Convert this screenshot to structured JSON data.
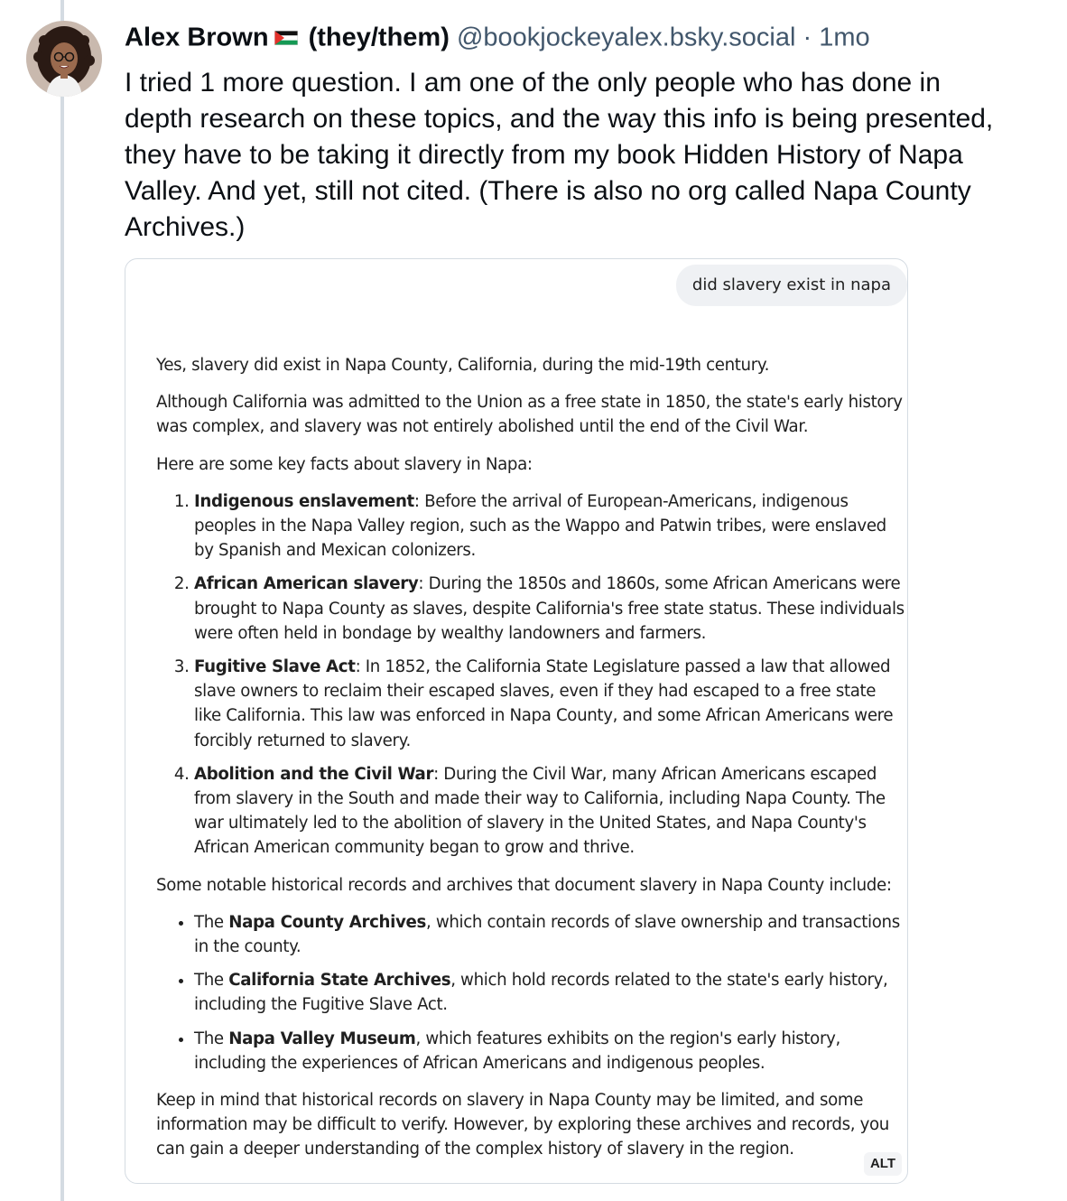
{
  "post": {
    "author_name": "Alex Brown",
    "pronouns": "(they/them)",
    "handle": "@bookjockeyalex.bsky.social",
    "separator": "·",
    "timestamp": "1mo",
    "flag_icon": "palestine-flag-icon",
    "text": "I tried 1 more question. I am one of the only people who has done in depth research on these topics, and the way this info is being presented, they have to be taking it directly from my book Hidden History of Napa Valley. And yet, still not cited. (There is also no org called Napa County Archives.)"
  },
  "image": {
    "alt_badge": "ALT",
    "user_query": "did slavery exist in napa",
    "intro": "Yes, slavery did exist in Napa County, California, during the mid-19th century.",
    "context": "Although California was admitted to the Union as a free state in 1850, the state's early history was complex, and slavery was not entirely abolished until the end of the Civil War.",
    "facts_heading": "Here are some key facts about slavery in Napa:",
    "facts": [
      {
        "title": "Indigenous enslavement",
        "text": ": Before the arrival of European-Americans, indigenous peoples in the Napa Valley region, such as the Wappo and Patwin tribes, were enslaved by Spanish and Mexican colonizers."
      },
      {
        "title": "African American slavery",
        "text": ": During the 1850s and 1860s, some African Americans were brought to Napa County as slaves, despite California's free state status. These individuals were often held in bondage by wealthy landowners and farmers."
      },
      {
        "title": "Fugitive Slave Act",
        "text": ": In 1852, the California State Legislature passed a law that allowed slave owners to reclaim their escaped slaves, even if they had escaped to a free state like California. This law was enforced in Napa County, and some African Americans were forcibly returned to slavery."
      },
      {
        "title": "Abolition and the Civil War",
        "text": ": During the Civil War, many African Americans escaped from slavery in the South and made their way to California, including Napa County. The war ultimately led to the abolition of slavery in the United States, and Napa County's African American community began to grow and thrive."
      }
    ],
    "records_heading": "Some notable historical records and archives that document slavery in Napa County include:",
    "records": [
      {
        "prefix": "The ",
        "name": "Napa County Archives",
        "text": ", which contain records of slave ownership and transactions in the county."
      },
      {
        "prefix": "The ",
        "name": "California State Archives",
        "text": ", which hold records related to the state's early history, including the Fugitive Slave Act."
      },
      {
        "prefix": "The ",
        "name": "Napa Valley Museum",
        "text": ", which features exhibits on the region's early history, including the experiences of African Americans and indigenous peoples."
      }
    ],
    "closing": "Keep in mind that historical records on slavery in Napa County may be limited, and some information may be difficult to verify. However, by exploring these archives and records, you can gain a deeper understanding of the complex history of slavery in the region."
  },
  "colors": {
    "thread_line": "#d4dbe2",
    "secondary_text": "#42576c",
    "border": "#d4dbe2",
    "bubble_bg": "#eff1f4"
  }
}
